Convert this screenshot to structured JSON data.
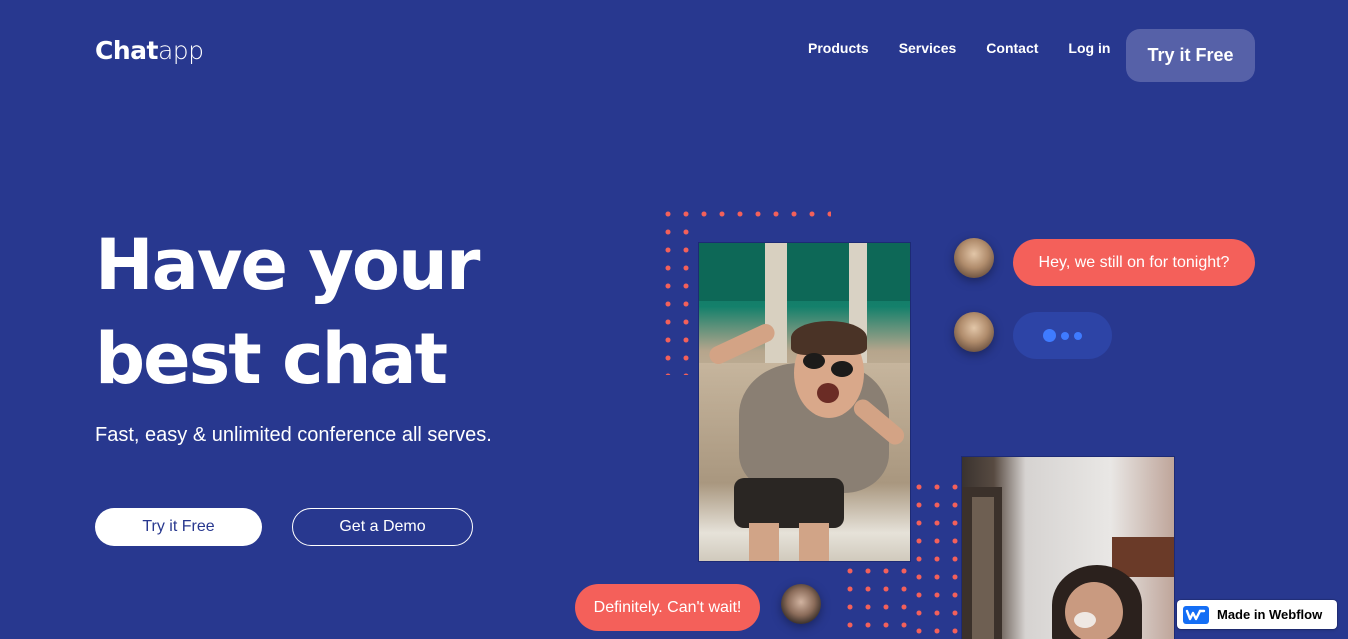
{
  "brand": {
    "bold": "Chat",
    "light": "app"
  },
  "nav": {
    "items": [
      {
        "label": "Products"
      },
      {
        "label": "Services"
      },
      {
        "label": "Contact"
      },
      {
        "label": "Log in"
      }
    ],
    "cta": "Try it Free"
  },
  "hero": {
    "title_line1": "Have your",
    "title_line2": "best chat",
    "subtitle": "Fast, easy & unlimited conference all serves.",
    "primary_cta": "Try it Free",
    "secondary_cta": "Get a Demo"
  },
  "chat": {
    "message_1": "Hey, we still on for tonight?",
    "message_2": "Definitely. Can't wait!"
  },
  "badge": {
    "label": "Made in Webflow"
  },
  "colors": {
    "background": "#28388f",
    "accent": "#f4605a",
    "nav_cta": "#5661a8",
    "typing_bubble": "#2d44a6",
    "typing_dot": "#3f7bff"
  }
}
